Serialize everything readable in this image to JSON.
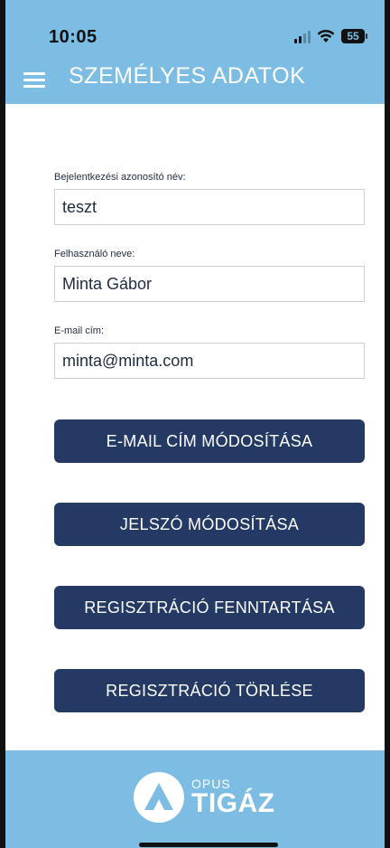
{
  "status_bar": {
    "time": "10:05",
    "battery": "55"
  },
  "header": {
    "title": "SZEMÉLYES ADATOK",
    "menu_icon": "hamburger-menu-icon",
    "background_color": "#7dbde3"
  },
  "form": {
    "login": {
      "label": "Bejelentkezési azonosító név:",
      "value": "teszt"
    },
    "username": {
      "label": "Felhasználó neve:",
      "value": "Minta Gábor"
    },
    "email": {
      "label": "E-mail cím:",
      "value": "minta@minta.com"
    }
  },
  "buttons": {
    "change_email": "E-MAIL CÍM MÓDOSÍTÁSA",
    "change_password": "JELSZÓ MÓDOSÍTÁSA",
    "maintain_registration": "REGISZTRÁCIÓ FENNTARTÁSA",
    "delete_registration": "REGISZTRÁCIÓ TÖRLÉSE",
    "color": "#243a64"
  },
  "footer": {
    "logo_top": "OPUS",
    "logo_bottom": "TIGÁZ"
  }
}
